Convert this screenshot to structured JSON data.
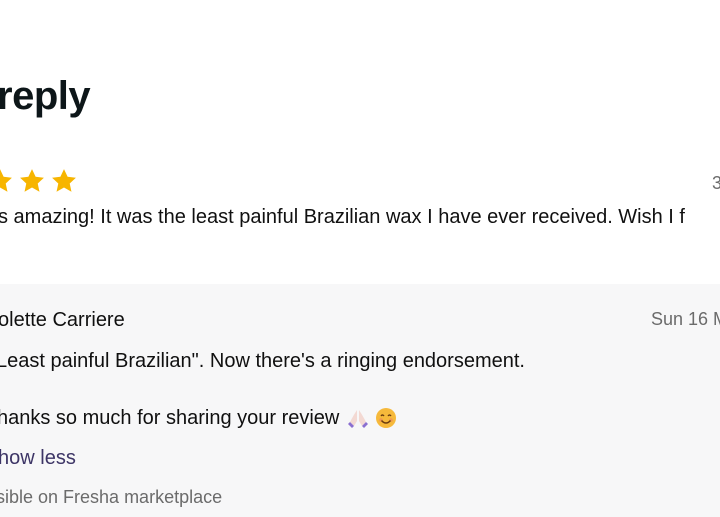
{
  "header": {
    "title": "reply"
  },
  "review": {
    "rating_stars_visible": 3,
    "star_color": "#f7b500",
    "date": "3",
    "text": "s amazing! It was the least painful Brazilian wax I have ever received. Wish I f"
  },
  "reply": {
    "author": "olette Carriere",
    "date": "Sun 16 M",
    "line1": "Least painful Brazilian\". Now there's a ringing endorsement.",
    "line2": "hanks so much for sharing your review",
    "emojis": [
      "folded-hands-icon",
      "smiling-face-icon"
    ],
    "show_less_label": "how less",
    "visibility_note": "sible on Fresha marketplace",
    "background_color": "#f7f7f8",
    "link_color": "#3d3566"
  }
}
